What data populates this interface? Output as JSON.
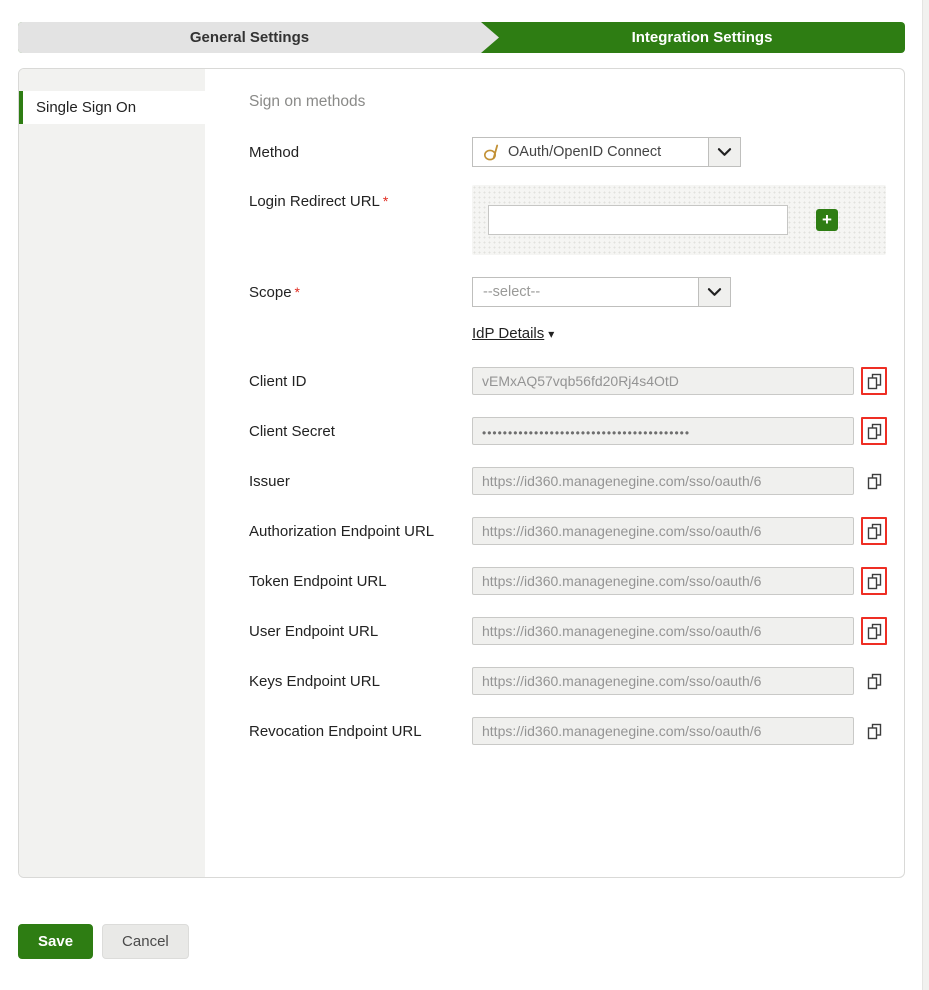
{
  "tabs": {
    "general": "General Settings",
    "integration": "Integration Settings"
  },
  "sidebar": {
    "sso": "Single Sign On"
  },
  "content": {
    "section_title": "Sign on methods",
    "method_label": "Method",
    "method_value": "OAuth/OpenID Connect",
    "login_redirect_label": "Login Redirect URL",
    "login_redirect_required": "*",
    "login_redirect_value": "",
    "add_button": "+",
    "scope_label": "Scope",
    "scope_required": "*",
    "scope_placeholder": "--select--",
    "idp_details_label": "IdP Details",
    "idp_caret": "▾"
  },
  "idp_rows": [
    {
      "label": "Client ID",
      "value": "vEMxAQ57vqb56fd20Rj4s4OtD"
    },
    {
      "label": "Client Secret",
      "value": "••••••••••••••••••••••••••••••••••••••••"
    },
    {
      "label": "Issuer",
      "value": "https://id360.managenegine.com/sso/oauth/6"
    },
    {
      "label": "Authorization Endpoint URL",
      "value": "https://id360.managenegine.com/sso/oauth/6"
    },
    {
      "label": "Token Endpoint URL",
      "value": "https://id360.managenegine.com/sso/oauth/6"
    },
    {
      "label": "User Endpoint URL",
      "value": "https://id360.managenegine.com/sso/oauth/6"
    },
    {
      "label": "Keys Endpoint URL",
      "value": "https://id360.managenegine.com/sso/oauth/6"
    },
    {
      "label": "Revocation Endpoint URL",
      "value": "https://id360.managenegine.com/sso/oauth/6"
    }
  ],
  "footer": {
    "save": "Save",
    "cancel": "Cancel"
  },
  "colors": {
    "accent_green": "#2e7d13",
    "highlight_red": "#ee2e24"
  }
}
